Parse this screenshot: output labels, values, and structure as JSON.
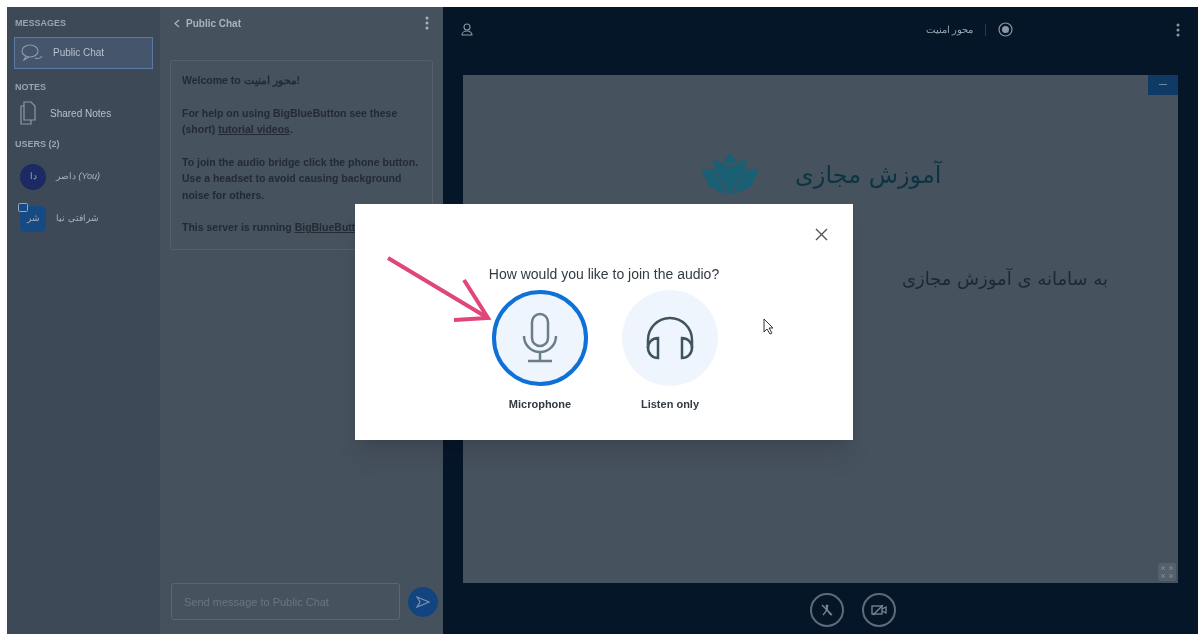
{
  "sidebar": {
    "messages_heading": "MESSAGES",
    "messages": [
      {
        "label": "Public Chat",
        "selected": true
      }
    ],
    "notes_heading": "NOTES",
    "notes": [
      {
        "label": "Shared Notes"
      }
    ],
    "users_heading": "USERS (2)",
    "users": [
      {
        "initials": "دا",
        "name": "داصر",
        "you_label": "(You)",
        "kind": "circle",
        "presenter": false
      },
      {
        "initials": "شر",
        "name": "شرافتی نیا",
        "kind": "square",
        "presenter": true
      }
    ]
  },
  "chat": {
    "title": "Public Chat",
    "paragraphs": [
      [
        {
          "kind": "text",
          "text": "Welcome to محور امنیت!"
        }
      ],
      [
        {
          "kind": "text",
          "text": "For help on using BigBlueButton see these (short) "
        },
        {
          "kind": "link",
          "text": "tutorial videos"
        },
        {
          "kind": "text",
          "text": "."
        }
      ],
      [
        {
          "kind": "text",
          "text": "To join the audio bridge click the phone button. Use a headset to avoid causing background noise for others."
        }
      ],
      [
        {
          "kind": "text",
          "text": "This server is running "
        },
        {
          "kind": "link",
          "text": "BigBlueButt"
        }
      ]
    ],
    "placeholder": "Send message to Public Chat"
  },
  "main": {
    "title": "محور امنیت",
    "slide": {
      "logo_text": "آموزش مجازی",
      "body": "به سامانه ی آموزش مجازی"
    }
  },
  "modal": {
    "question": "How would you like to join the audio?",
    "options": [
      {
        "label": "Microphone",
        "kind": "microphone",
        "selected": true
      },
      {
        "label": "Listen only",
        "kind": "headphones",
        "selected": false
      }
    ]
  }
}
